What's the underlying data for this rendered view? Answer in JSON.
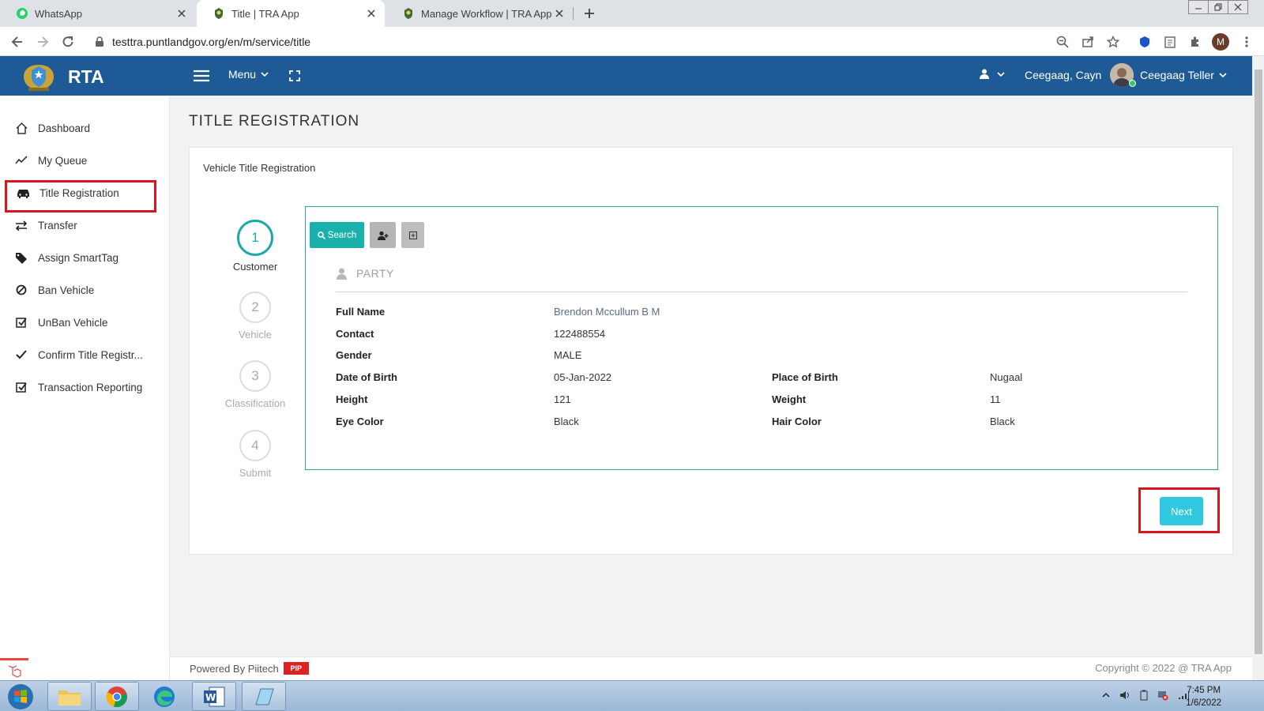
{
  "browser": {
    "tabs": [
      {
        "label": "WhatsApp",
        "icon": "whatsapp-icon"
      },
      {
        "label": "Title | TRA App",
        "icon": "coat-of-arms-icon",
        "active": true
      },
      {
        "label": "Manage Workflow | TRA App",
        "icon": "coat-of-arms-icon"
      }
    ],
    "url": "testtra.puntlandgov.org/en/m/service/title",
    "profile_initial": "M"
  },
  "header": {
    "brand": "RTA",
    "menu_label": "Menu",
    "user_name": "Ceegaag, Cayn",
    "role_label": "Ceegaag Teller",
    "color": "#1d5a96"
  },
  "sidebar": {
    "items": [
      {
        "label": "Dashboard",
        "icon": "home-icon"
      },
      {
        "label": "My Queue",
        "icon": "trend-line-icon"
      },
      {
        "label": "Title Registration",
        "icon": "car-icon",
        "highlighted": true
      },
      {
        "label": "Transfer",
        "icon": "exchange-icon"
      },
      {
        "label": "Assign SmartTag",
        "icon": "tags-icon"
      },
      {
        "label": "Ban Vehicle",
        "icon": "ban-icon"
      },
      {
        "label": "UnBan Vehicle",
        "icon": "check-square-icon"
      },
      {
        "label": "Confirm Title Registr...",
        "icon": "check-icon"
      },
      {
        "label": "Transaction Reporting",
        "icon": "check-square-icon"
      }
    ]
  },
  "page": {
    "title": "TITLE REGISTRATION",
    "card_title": "Vehicle Title Registration",
    "steps": [
      {
        "number": "1",
        "label": "Customer",
        "active": true
      },
      {
        "number": "2",
        "label": "Vehicle"
      },
      {
        "number": "3",
        "label": "Classification"
      },
      {
        "number": "4",
        "label": "Submit"
      }
    ],
    "search_label": "Search",
    "section_title": "PARTY",
    "fields": {
      "full_name": {
        "label": "Full Name",
        "value": "Brendon Mccullum B M"
      },
      "contact": {
        "label": "Contact",
        "value": "122488554"
      },
      "gender": {
        "label": "Gender",
        "value": "MALE"
      },
      "dob": {
        "label": "Date of Birth",
        "value": "05-Jan-2022"
      },
      "pob": {
        "label": "Place of Birth",
        "value": "Nugaal"
      },
      "height": {
        "label": "Height",
        "value": "121"
      },
      "weight": {
        "label": "Weight",
        "value": "11"
      },
      "eye_color": {
        "label": "Eye Color",
        "value": "Black"
      },
      "hair_color": {
        "label": "Hair Color",
        "value": "Black"
      }
    },
    "next_label": "Next",
    "accent": "#1ab1ad"
  },
  "footer": {
    "powered_by": "Powered By Piitech",
    "logo_text": "PIP",
    "copyright": "Copyright © 2022 @ TRA App"
  },
  "taskbar": {
    "time": "7:45 PM",
    "date": "1/6/2022"
  }
}
